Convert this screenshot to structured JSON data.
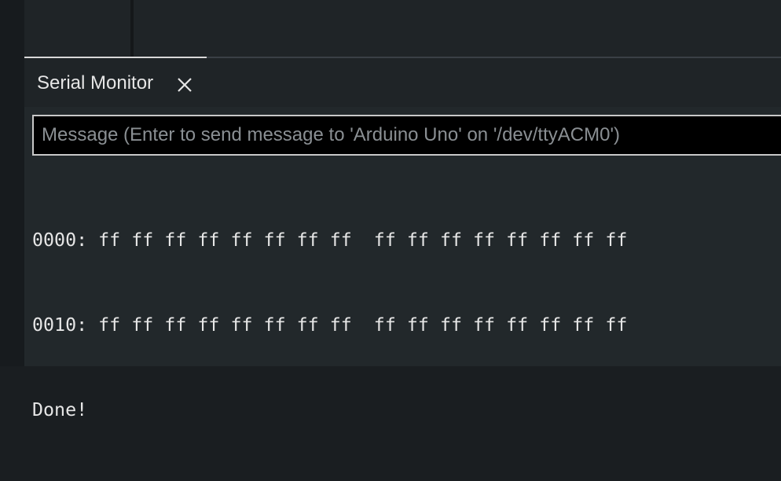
{
  "tab": {
    "label": "Serial Monitor"
  },
  "input": {
    "placeholder": "Message (Enter to send message to 'Arduino Uno' on '/dev/ttyACM0')",
    "value": ""
  },
  "output": {
    "lines": [
      "0000: ff ff ff ff ff ff ff ff  ff ff ff ff ff ff ff ff",
      "0010: ff ff ff ff ff ff ff ff  ff ff ff ff ff ff ff ff",
      "Done!"
    ]
  },
  "icons": {
    "close": "close-icon"
  },
  "colors": {
    "background": "#22282b",
    "text": "#e6e6e6",
    "input_background": "#000000",
    "input_border": "#c8c8c8"
  }
}
